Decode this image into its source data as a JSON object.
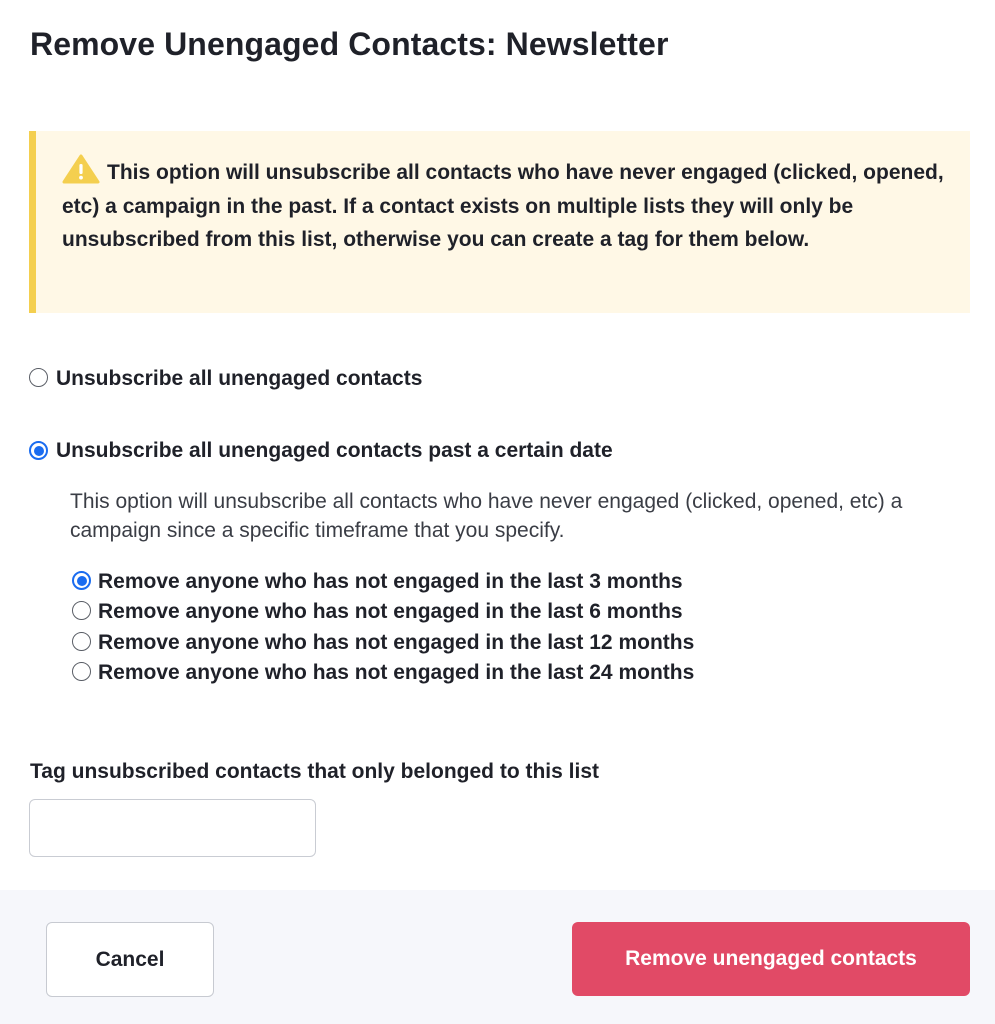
{
  "dialog": {
    "title": "Remove Unengaged Contacts: Newsletter"
  },
  "alert": {
    "icon": "warning-icon",
    "color": "#f4cf4f",
    "background": "#fff8e6",
    "text": "This option will unsubscribe all contacts who have never engaged (clicked, opened, etc) a campaign in the past. If a contact exists on multiple lists they will only be unsubscribed from this list, otherwise you can create a tag for them below."
  },
  "mode_options": [
    {
      "label": "Unsubscribe all unengaged contacts",
      "selected": false
    },
    {
      "label": "Unsubscribe all unengaged contacts past a certain date",
      "selected": true
    }
  ],
  "date_option": {
    "description": "This option will unsubscribe all contacts who have never engaged (clicked, opened, etc) a campaign since a specific timeframe that you specify."
  },
  "timeframes": [
    {
      "label": "Remove anyone who has not engaged in the last 3 months",
      "selected": true
    },
    {
      "label": "Remove anyone who has not engaged in the last 6 months",
      "selected": false
    },
    {
      "label": "Remove anyone who has not engaged in the last 12 months",
      "selected": false
    },
    {
      "label": "Remove anyone who has not engaged in the last 24 months",
      "selected": false
    }
  ],
  "tag": {
    "label": "Tag unsubscribed contacts that only belonged to this list",
    "value": "",
    "placeholder": ""
  },
  "footer": {
    "cancel_label": "Cancel",
    "submit_label": "Remove unengaged contacts",
    "submit_color": "#e14a66"
  },
  "colors": {
    "radio_selected": "#1a6cf0"
  }
}
